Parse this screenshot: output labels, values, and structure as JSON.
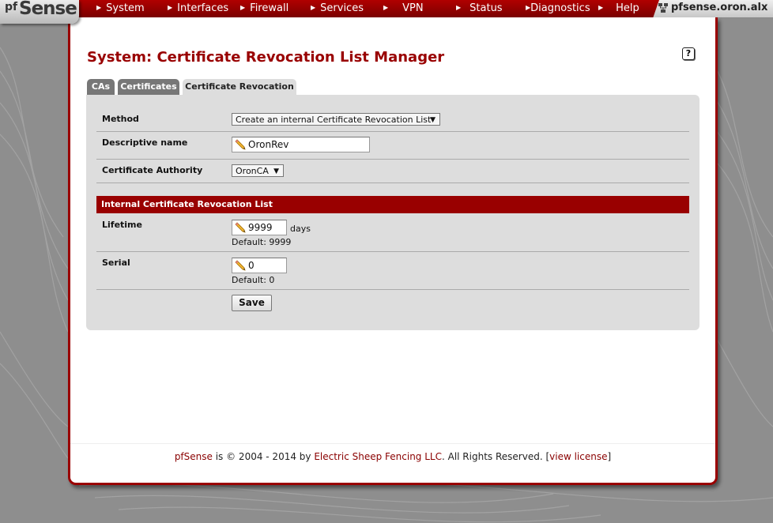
{
  "brand": {
    "logo_prefix": "pf",
    "logo_text": "Sense"
  },
  "nav": {
    "items": [
      {
        "label": "System"
      },
      {
        "label": "Interfaces"
      },
      {
        "label": "Firewall"
      },
      {
        "label": "Services"
      },
      {
        "label": "VPN"
      },
      {
        "label": "Status"
      },
      {
        "label": "Diagnostics"
      },
      {
        "label": "Help"
      }
    ],
    "hostname": "pfsense.oron.alx"
  },
  "page": {
    "title": "System: Certificate Revocation List Manager",
    "help_icon_label": "?"
  },
  "tabs": [
    {
      "label": "CAs",
      "active": false
    },
    {
      "label": "Certificates",
      "active": false
    },
    {
      "label": "Certificate Revocation",
      "active": true
    }
  ],
  "form": {
    "method": {
      "label": "Method",
      "value": "Create an internal Certificate Revocation List"
    },
    "descriptive_name": {
      "label": "Descriptive name",
      "value": "OronRev"
    },
    "certificate_authority": {
      "label": "Certificate Authority",
      "value": "OronCA"
    },
    "section_header": "Internal Certificate Revocation List",
    "lifetime": {
      "label": "Lifetime",
      "value": "9999",
      "unit": "days",
      "hint": "Default: 9999"
    },
    "serial": {
      "label": "Serial",
      "value": "0",
      "hint": "Default: 0"
    },
    "save_label": "Save"
  },
  "footer": {
    "product": "pfSense",
    "text_middle": " is © 2004 - 2014 by ",
    "company": "Electric Sheep Fencing LLC",
    "text_end": ". All Rights Reserved. [",
    "license_link": "view license",
    "text_close": "]"
  },
  "colors": {
    "accent": "#990000",
    "panel_border": "#9a0000",
    "form_background": "#dddddd",
    "background": "#8e8e8e"
  }
}
